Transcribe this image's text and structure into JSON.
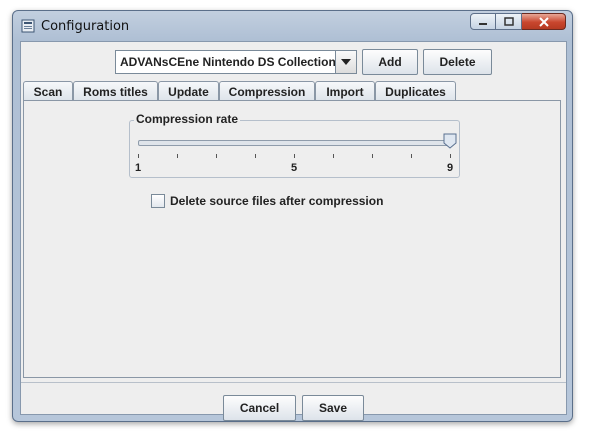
{
  "window": {
    "title": "Configuration"
  },
  "collection": {
    "selected": "ADVANsCEne Nintendo DS Collection"
  },
  "buttons": {
    "add": "Add",
    "delete": "Delete",
    "cancel": "Cancel",
    "save": "Save"
  },
  "tabs": [
    {
      "label": "Scan"
    },
    {
      "label": "Roms titles"
    },
    {
      "label": "Update"
    },
    {
      "label": "Compression",
      "active": true
    },
    {
      "label": "Import"
    },
    {
      "label": "Duplicates"
    }
  ],
  "compression": {
    "group_title": "Compression rate",
    "min_label": "1",
    "mid_label": "5",
    "max_label": "9",
    "value": 9,
    "delete_source_label": "Delete source files after compression",
    "delete_source_checked": false
  }
}
